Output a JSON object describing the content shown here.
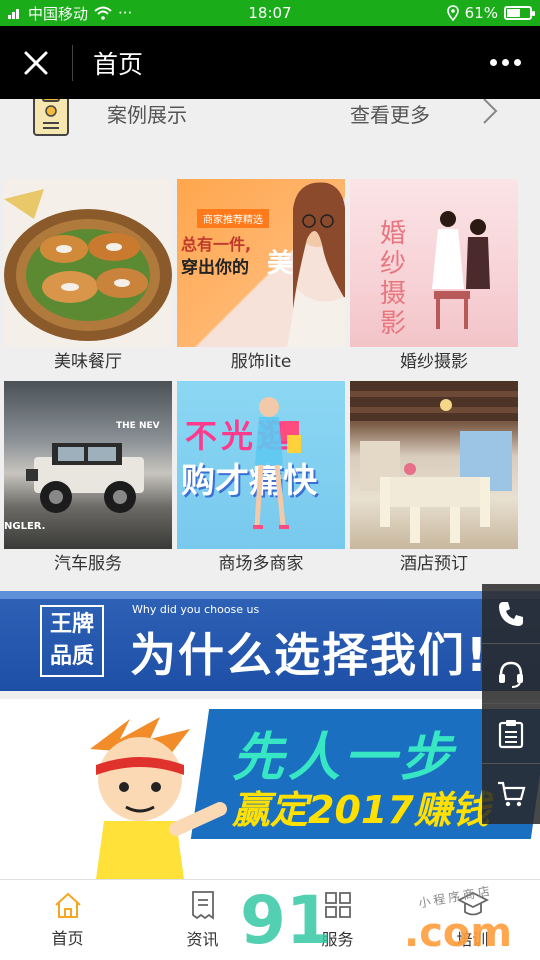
{
  "status_bar": {
    "carrier": "中国移动",
    "signal_glyphs": "···",
    "time": "18:07",
    "battery_percent": "61%",
    "battery_level": 0.61
  },
  "nav": {
    "title": "首页"
  },
  "cases": {
    "title": "案例展示",
    "more_label": "查看更多"
  },
  "grid": [
    {
      "caption": "美味餐厅",
      "picture": "food"
    },
    {
      "caption": "服饰lite",
      "picture": "fashion",
      "overlay_tag": "商家推荐精选",
      "overlay_line1": "总有一件,",
      "overlay_line2": "穿出你的",
      "overlay_accent": "美"
    },
    {
      "caption": "婚纱摄影",
      "picture": "wedding",
      "overlay_chars": "婚纱摄影"
    },
    {
      "caption": "汽车服务",
      "picture": "car",
      "overlay_text": "THE NEV",
      "overlay_text2": "NGLER."
    },
    {
      "caption": "商场多商家",
      "picture": "mall",
      "overlay_line1": "不光逛",
      "overlay_line2": "购才痛快"
    },
    {
      "caption": "酒店预订",
      "picture": "hotel"
    }
  ],
  "banner1": {
    "badge_line1": "王牌",
    "badge_line2": "品质",
    "subtitle": "Why did you choose us",
    "title": "为什么选择我们!"
  },
  "banner2": {
    "line1": "先人一步",
    "line2": "赢定2017赚钱"
  },
  "side_buttons": [
    "phone-icon",
    "headset-icon",
    "clipboard-icon",
    "cart-icon"
  ],
  "tabs": [
    {
      "label": "首页",
      "icon": "home-icon",
      "active": true
    },
    {
      "label": "资讯",
      "icon": "news-icon",
      "active": false
    },
    {
      "label": "服务",
      "icon": "service-icon",
      "active": false
    },
    {
      "label": "培训",
      "icon": "training-icon",
      "active": false
    }
  ],
  "watermark": {
    "main": "91",
    "suffix": ".com",
    "tag": "小程序商店"
  },
  "colors": {
    "status_bar": "#1aac19",
    "nav_bar": "#000000",
    "banner_blue": "#2f63b7",
    "active_tab": "#f5a623"
  }
}
